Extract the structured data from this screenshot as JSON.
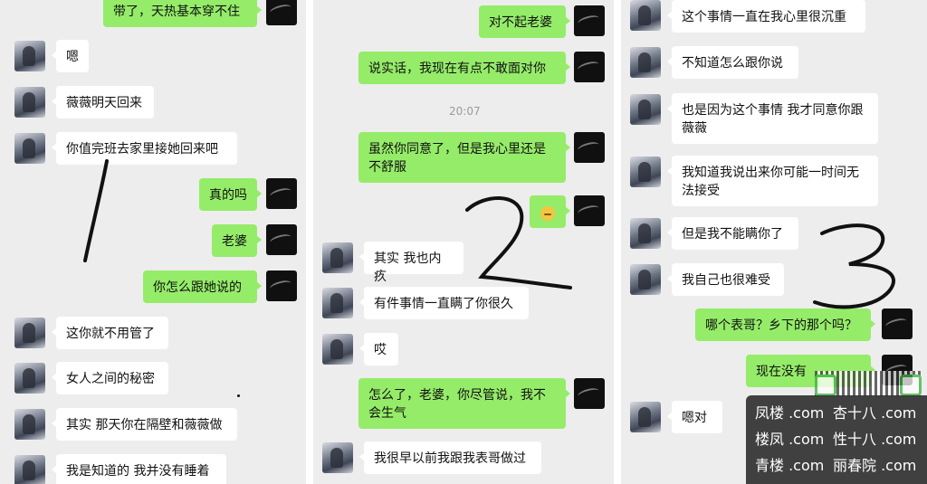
{
  "panel1": {
    "messages": [
      {
        "from": "me",
        "text": "带了，天热基本穿不住"
      },
      {
        "from": "them",
        "text": "嗯"
      },
      {
        "from": "them",
        "text": "薇薇明天回来"
      },
      {
        "from": "them",
        "text": "你值完班去家里接她回来吧"
      },
      {
        "from": "me",
        "text": "真的吗"
      },
      {
        "from": "me",
        "text": "老婆"
      },
      {
        "from": "me",
        "text": "你怎么跟她说的"
      },
      {
        "from": "them",
        "text": "这你就不用管了"
      },
      {
        "from": "them",
        "text": "女人之间的秘密"
      },
      {
        "from": "them",
        "text": "其实 那天你在隔壁和薇薇做"
      },
      {
        "from": "them",
        "text": "我是知道的 我并没有睡着"
      }
    ],
    "annotation": "1"
  },
  "panel2": {
    "messages": [
      {
        "from": "me",
        "text": "对不起老婆"
      },
      {
        "from": "me",
        "text": "说实话，我现在有点不敢面对你"
      },
      {
        "from": "me",
        "line1": "虽然你同意了，但是我心里还是",
        "line2": "不舒服"
      },
      {
        "from": "me",
        "emoji": "flushed-face-emoji"
      },
      {
        "from": "them",
        "text": "其实 我也内疚"
      },
      {
        "from": "them",
        "text": "有件事情一直瞒了你很久"
      },
      {
        "from": "them",
        "text": "哎"
      },
      {
        "from": "me",
        "line1": "怎么了，老婆，你尽管说，我不",
        "line2": "会生气"
      },
      {
        "from": "them",
        "text": "我很早以前我跟我表哥做过"
      }
    ],
    "time": "20:07",
    "annotation": "2"
  },
  "panel3": {
    "messages": [
      {
        "from": "them",
        "text": "这个事情一直在我心里很沉重"
      },
      {
        "from": "them",
        "text": "不知道怎么跟你说"
      },
      {
        "from": "them",
        "line1": "也是因为这个事情 我才同意你跟",
        "line2": "薇薇"
      },
      {
        "from": "them",
        "line1": "我知道我说出来你可能一时间无",
        "line2": "法接受"
      },
      {
        "from": "them",
        "text": "但是我不能瞒你了"
      },
      {
        "from": "them",
        "text": "我自己也很难受"
      },
      {
        "from": "me",
        "text": "哪个表哥？乡下的那个吗？"
      },
      {
        "from": "me",
        "text": "现在没有"
      },
      {
        "from": "them",
        "text": "嗯对"
      }
    ],
    "annotation": "3"
  },
  "watermark": {
    "rows": [
      [
        "凤楼 .com",
        "杏十八 .com"
      ],
      [
        "楼凤 .com",
        "性十八 .com"
      ],
      [
        "青楼 .com",
        "丽春院 .com"
      ]
    ]
  },
  "colors": {
    "my_bubble": "#95ec69",
    "their_bubble": "#ffffff",
    "chat_bg": "#ededed"
  }
}
